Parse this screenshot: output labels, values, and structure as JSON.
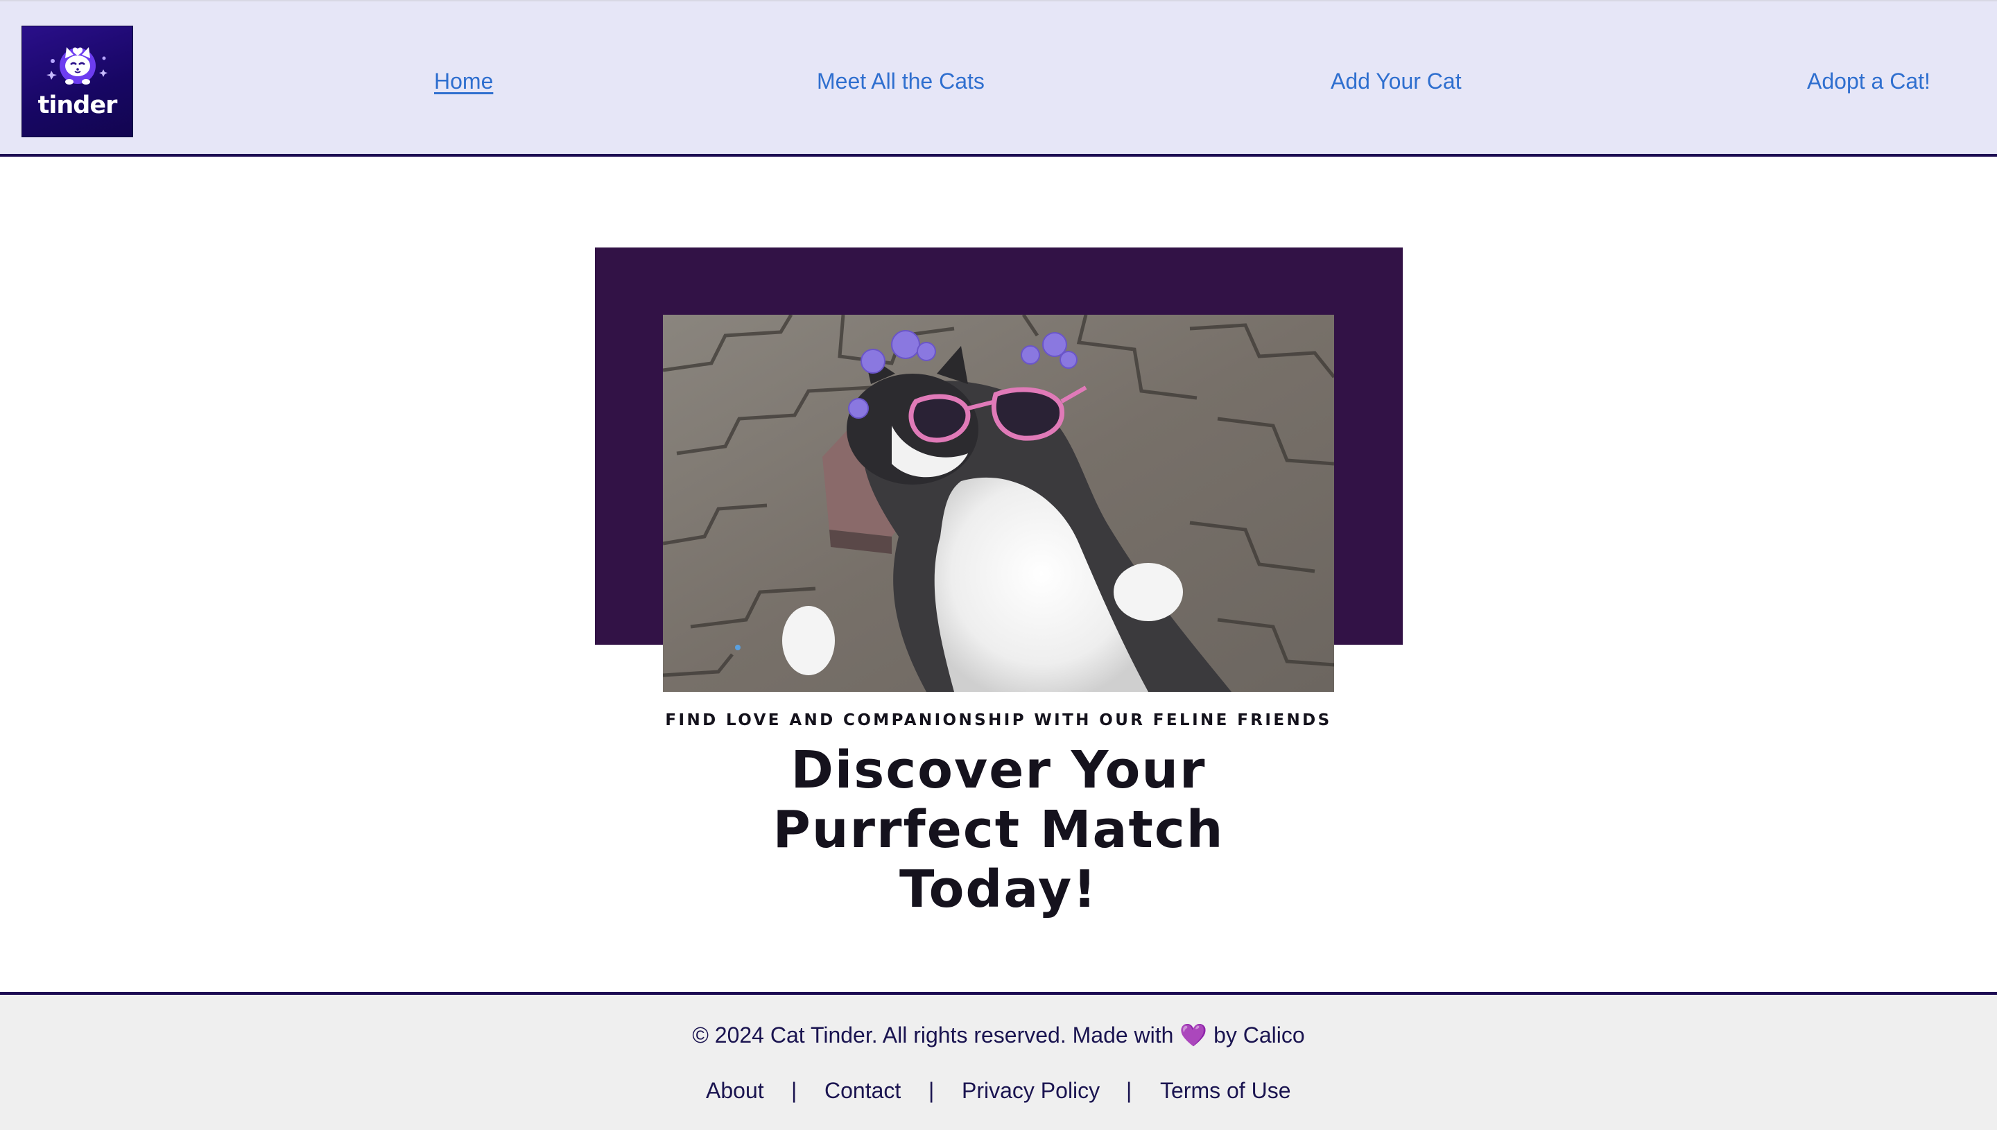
{
  "header": {
    "logo_text": "tinder",
    "nav": [
      {
        "label": "Home",
        "active": true
      },
      {
        "label": "Meet All the Cats",
        "active": false
      },
      {
        "label": "Add Your Cat",
        "active": false
      },
      {
        "label": "Adopt a Cat!",
        "active": false
      }
    ]
  },
  "hero": {
    "eyebrow": "FIND LOVE AND COMPANIONSHIP WITH OUR FELINE FRIENDS",
    "headline_lines": [
      "Discover Your",
      "Purrfect Match",
      "Today!"
    ]
  },
  "footer": {
    "copyright_text": "© 2024 Cat Tinder. All rights reserved. Made with",
    "heart": "💜",
    "copyright_suffix": "by Calico",
    "links": [
      "About",
      "Contact",
      "Privacy Policy",
      "Terms of Use"
    ],
    "separator": "|"
  },
  "colors": {
    "header_bg": "#e6e6f7",
    "header_border": "#1c0b52",
    "nav_link": "#2f6fcf",
    "hero_block": "#321246",
    "footer_bg": "#efefef",
    "heart": "#9b3fe0"
  }
}
